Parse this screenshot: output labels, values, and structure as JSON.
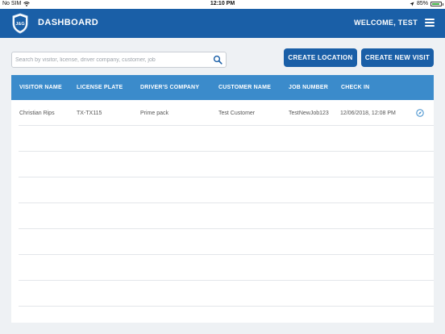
{
  "status_bar": {
    "carrier": "No SIM",
    "time": "12:10 PM",
    "battery": "85%",
    "battery_level": 0.85,
    "wifi_icon": "wifi-icon",
    "location_icon": "location-arrow-icon"
  },
  "header": {
    "logo_text": "J&G",
    "title": "DASHBOARD",
    "welcome": "WELCOME, TEST",
    "menu_icon": "hamburger-menu-icon"
  },
  "toolbar": {
    "search_placeholder": "Search by visitor, license, driver company, customer, job",
    "search_value": "",
    "create_location": "CREATE LOCATION",
    "create_visit": "CREATE NEW VISIT"
  },
  "table": {
    "columns": [
      "VISITOR NAME",
      "LICENSE PLATE",
      "DRIVER'S COMPANY",
      "CUSTOMER NAME",
      "JOB NUMBER",
      "CHECK IN"
    ],
    "rows": [
      {
        "visitor_name": "Christian Rips",
        "license_plate": "TX-TX115",
        "drivers_company": "Prime pack",
        "customer_name": "Test Customer",
        "job_number": "TestNewJob123",
        "check_in": "12/06/2018, 12:08 PM",
        "action_icon": "compass-icon"
      }
    ],
    "empty_rows": 7
  },
  "colors": {
    "primary": "#1a5fa7",
    "table_header": "#3b8bcb",
    "background": "#eef1f4"
  }
}
